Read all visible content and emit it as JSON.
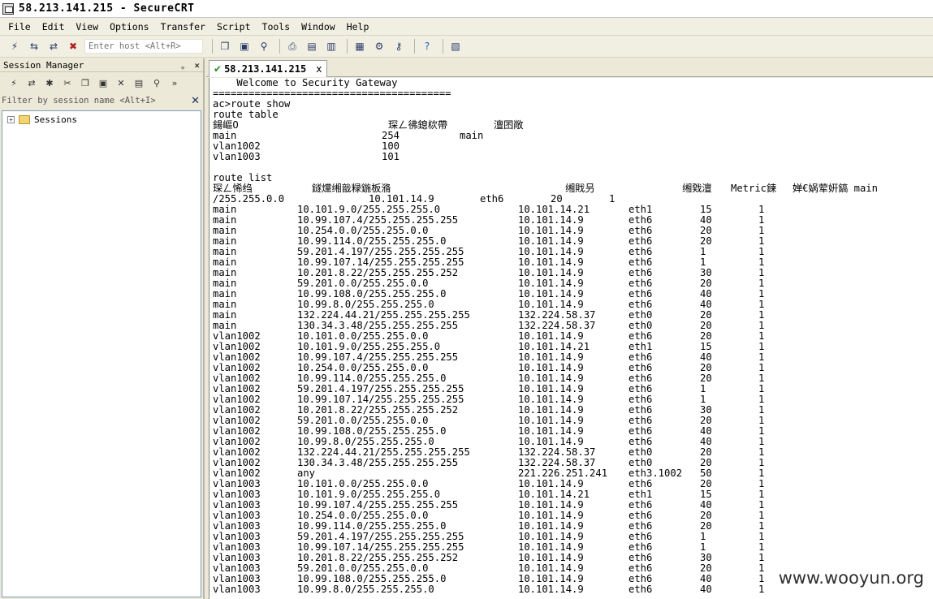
{
  "window": {
    "title": "58.213.141.215 - SecureCRT"
  },
  "menu": [
    "File",
    "Edit",
    "View",
    "Options",
    "Transfer",
    "Script",
    "Tools",
    "Window",
    "Help"
  ],
  "toolbar": {
    "host_placeholder": "Enter host <Alt+R>"
  },
  "session_manager": {
    "title": "Session Manager",
    "pin": "ᵩ",
    "close": "✕",
    "filter_placeholder": "Filter by session name <Alt+I>",
    "root": "Sessions"
  },
  "tab": {
    "label": "58.213.141.215",
    "close": "x"
  },
  "terminal": {
    "welcome": "    Welcome to Security Gateway",
    "separator": "========================================",
    "prompt": "ac>route show",
    "table_title": "route table",
    "table_header": {
      "c1": "鍚嶇О",
      "c2": "琛ㄥ彿鎴栨帶",
      "c3": "澶囨敞"
    },
    "tables": [
      {
        "name": "main",
        "id": "254",
        "note": "main"
      },
      {
        "name": "vlan1002",
        "id": "100",
        "note": ""
      },
      {
        "name": "vlan1003",
        "id": "101",
        "note": ""
      }
    ],
    "list_title": "route list",
    "list_header": {
      "c1": "琛ㄥ悕绉",
      "c2": "鐩爣缃戠粶鍦板潃",
      "c3": "缃戝叧",
      "c4": "缃戣澶",
      "c5": "Metric鍊",
      "c6": "婵€娲荤姸鎬 main"
    },
    "wrap_line": {
      "a": "/255.255.0.0",
      "b": "10.101.14.9",
      "c": "eth6",
      "d": "20",
      "e": "1"
    },
    "routes": [
      {
        "table": "main",
        "dest": "10.101.9.0/255.255.255.0",
        "gw": "10.101.14.21",
        "dev": "eth1",
        "metric": "15",
        "active": "1"
      },
      {
        "table": "main",
        "dest": "10.99.107.4/255.255.255.255",
        "gw": "10.101.14.9",
        "dev": "eth6",
        "metric": "40",
        "active": "1"
      },
      {
        "table": "main",
        "dest": "10.254.0.0/255.255.0.0",
        "gw": "10.101.14.9",
        "dev": "eth6",
        "metric": "20",
        "active": "1"
      },
      {
        "table": "main",
        "dest": "10.99.114.0/255.255.255.0",
        "gw": "10.101.14.9",
        "dev": "eth6",
        "metric": "20",
        "active": "1"
      },
      {
        "table": "main",
        "dest": "59.201.4.197/255.255.255.255",
        "gw": "10.101.14.9",
        "dev": "eth6",
        "metric": "1",
        "active": "1"
      },
      {
        "table": "main",
        "dest": "10.99.107.14/255.255.255.255",
        "gw": "10.101.14.9",
        "dev": "eth6",
        "metric": "1",
        "active": "1"
      },
      {
        "table": "main",
        "dest": "10.201.8.22/255.255.255.252",
        "gw": "10.101.14.9",
        "dev": "eth6",
        "metric": "30",
        "active": "1"
      },
      {
        "table": "main",
        "dest": "59.201.0.0/255.255.0.0",
        "gw": "10.101.14.9",
        "dev": "eth6",
        "metric": "20",
        "active": "1"
      },
      {
        "table": "main",
        "dest": "10.99.108.0/255.255.255.0",
        "gw": "10.101.14.9",
        "dev": "eth6",
        "metric": "40",
        "active": "1"
      },
      {
        "table": "main",
        "dest": "10.99.8.0/255.255.255.0",
        "gw": "10.101.14.9",
        "dev": "eth6",
        "metric": "40",
        "active": "1"
      },
      {
        "table": "main",
        "dest": "132.224.44.21/255.255.255.255",
        "gw": "132.224.58.37",
        "dev": "eth0",
        "metric": "20",
        "active": "1"
      },
      {
        "table": "main",
        "dest": "130.34.3.48/255.255.255.255",
        "gw": "132.224.58.37",
        "dev": "eth0",
        "metric": "20",
        "active": "1"
      },
      {
        "table": "vlan1002",
        "dest": "10.101.0.0/255.255.0.0",
        "gw": "10.101.14.9",
        "dev": "eth6",
        "metric": "20",
        "active": "1"
      },
      {
        "table": "vlan1002",
        "dest": "10.101.9.0/255.255.255.0",
        "gw": "10.101.14.21",
        "dev": "eth1",
        "metric": "15",
        "active": "1"
      },
      {
        "table": "vlan1002",
        "dest": "10.99.107.4/255.255.255.255",
        "gw": "10.101.14.9",
        "dev": "eth6",
        "metric": "40",
        "active": "1"
      },
      {
        "table": "vlan1002",
        "dest": "10.254.0.0/255.255.0.0",
        "gw": "10.101.14.9",
        "dev": "eth6",
        "metric": "20",
        "active": "1"
      },
      {
        "table": "vlan1002",
        "dest": "10.99.114.0/255.255.255.0",
        "gw": "10.101.14.9",
        "dev": "eth6",
        "metric": "20",
        "active": "1"
      },
      {
        "table": "vlan1002",
        "dest": "59.201.4.197/255.255.255.255",
        "gw": "10.101.14.9",
        "dev": "eth6",
        "metric": "1",
        "active": "1"
      },
      {
        "table": "vlan1002",
        "dest": "10.99.107.14/255.255.255.255",
        "gw": "10.101.14.9",
        "dev": "eth6",
        "metric": "1",
        "active": "1"
      },
      {
        "table": "vlan1002",
        "dest": "10.201.8.22/255.255.255.252",
        "gw": "10.101.14.9",
        "dev": "eth6",
        "metric": "30",
        "active": "1"
      },
      {
        "table": "vlan1002",
        "dest": "59.201.0.0/255.255.0.0",
        "gw": "10.101.14.9",
        "dev": "eth6",
        "metric": "20",
        "active": "1"
      },
      {
        "table": "vlan1002",
        "dest": "10.99.108.0/255.255.255.0",
        "gw": "10.101.14.9",
        "dev": "eth6",
        "metric": "40",
        "active": "1"
      },
      {
        "table": "vlan1002",
        "dest": "10.99.8.0/255.255.255.0",
        "gw": "10.101.14.9",
        "dev": "eth6",
        "metric": "40",
        "active": "1"
      },
      {
        "table": "vlan1002",
        "dest": "132.224.44.21/255.255.255.255",
        "gw": "132.224.58.37",
        "dev": "eth0",
        "metric": "20",
        "active": "1"
      },
      {
        "table": "vlan1002",
        "dest": "130.34.3.48/255.255.255.255",
        "gw": "132.224.58.37",
        "dev": "eth0",
        "metric": "20",
        "active": "1"
      },
      {
        "table": "vlan1002",
        "dest": "any",
        "gw": "221.226.251.241",
        "dev": "eth3.1002",
        "metric": "50",
        "active": "1"
      },
      {
        "table": "vlan1003",
        "dest": "10.101.0.0/255.255.0.0",
        "gw": "10.101.14.9",
        "dev": "eth6",
        "metric": "20",
        "active": "1"
      },
      {
        "table": "vlan1003",
        "dest": "10.101.9.0/255.255.255.0",
        "gw": "10.101.14.21",
        "dev": "eth1",
        "metric": "15",
        "active": "1"
      },
      {
        "table": "vlan1003",
        "dest": "10.99.107.4/255.255.255.255",
        "gw": "10.101.14.9",
        "dev": "eth6",
        "metric": "40",
        "active": "1"
      },
      {
        "table": "vlan1003",
        "dest": "10.254.0.0/255.255.0.0",
        "gw": "10.101.14.9",
        "dev": "eth6",
        "metric": "20",
        "active": "1"
      },
      {
        "table": "vlan1003",
        "dest": "10.99.114.0/255.255.255.0",
        "gw": "10.101.14.9",
        "dev": "eth6",
        "metric": "20",
        "active": "1"
      },
      {
        "table": "vlan1003",
        "dest": "59.201.4.197/255.255.255.255",
        "gw": "10.101.14.9",
        "dev": "eth6",
        "metric": "1",
        "active": "1"
      },
      {
        "table": "vlan1003",
        "dest": "10.99.107.14/255.255.255.255",
        "gw": "10.101.14.9",
        "dev": "eth6",
        "metric": "1",
        "active": "1"
      },
      {
        "table": "vlan1003",
        "dest": "10.201.8.22/255.255.255.252",
        "gw": "10.101.14.9",
        "dev": "eth6",
        "metric": "30",
        "active": "1"
      },
      {
        "table": "vlan1003",
        "dest": "59.201.0.0/255.255.0.0",
        "gw": "10.101.14.9",
        "dev": "eth6",
        "metric": "20",
        "active": "1"
      },
      {
        "table": "vlan1003",
        "dest": "10.99.108.0/255.255.255.0",
        "gw": "10.101.14.9",
        "dev": "eth6",
        "metric": "40",
        "active": "1"
      },
      {
        "table": "vlan1003",
        "dest": "10.99.8.0/255.255.255.0",
        "gw": "10.101.14.9",
        "dev": "eth6",
        "metric": "40",
        "active": "1"
      }
    ]
  },
  "watermark": "www.wooyun.org"
}
